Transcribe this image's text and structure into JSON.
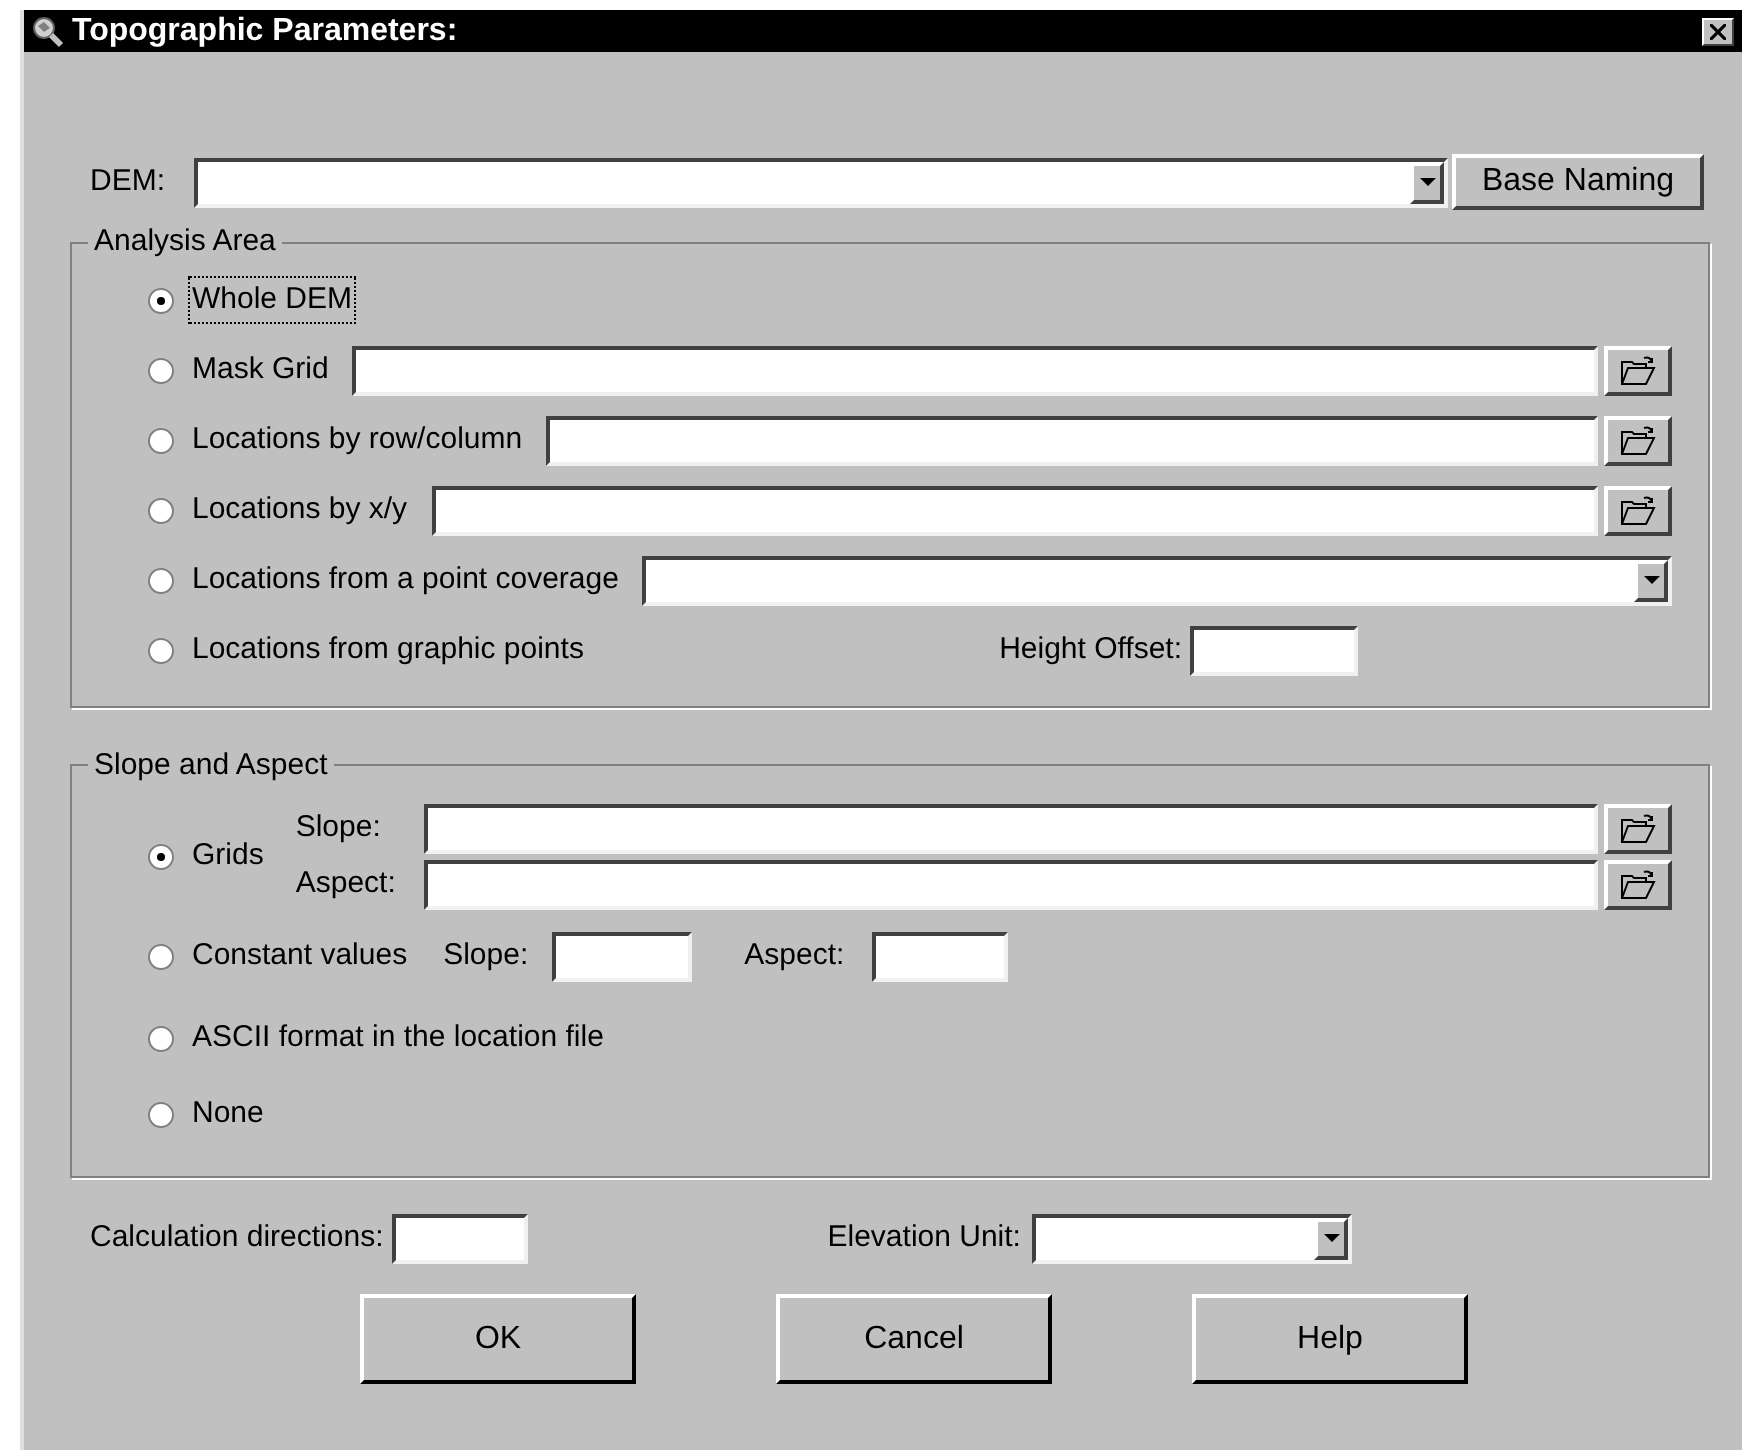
{
  "window": {
    "title": "Topographic Parameters:"
  },
  "dem": {
    "label": "DEM:"
  },
  "base_naming_button": "Base Naming",
  "analysis_area": {
    "title": "Analysis Area",
    "options": [
      {
        "label": "Whole DEM",
        "selected": true,
        "focused": true,
        "kind": "plain"
      },
      {
        "label": "Mask Grid",
        "selected": false,
        "focused": false,
        "kind": "browse"
      },
      {
        "label": "Locations by row/column",
        "selected": false,
        "focused": false,
        "kind": "browse"
      },
      {
        "label": "Locations by x/y",
        "selected": false,
        "focused": false,
        "kind": "browse"
      },
      {
        "label": "Locations from a point coverage",
        "selected": false,
        "focused": false,
        "kind": "dropdown"
      },
      {
        "label": "Locations from graphic points",
        "selected": false,
        "focused": false,
        "kind": "offset",
        "offset_label": "Height Offset:"
      }
    ]
  },
  "slope_aspect": {
    "title": "Slope and Aspect",
    "options": [
      {
        "label": "Grids",
        "selected": true,
        "kind": "grids",
        "slope_label": "Slope:",
        "aspect_label": "Aspect:"
      },
      {
        "label": "Constant values",
        "selected": false,
        "kind": "constants",
        "slope_label": "Slope:",
        "aspect_label": "Aspect:"
      },
      {
        "label": "ASCII format in the location file",
        "selected": false,
        "kind": "plain"
      },
      {
        "label": "None",
        "selected": false,
        "kind": "plain"
      }
    ]
  },
  "calculation_directions": {
    "label": "Calculation directions:"
  },
  "elevation_unit": {
    "label": "Elevation Unit:"
  },
  "buttons": [
    "OK",
    "Cancel",
    "Help"
  ]
}
